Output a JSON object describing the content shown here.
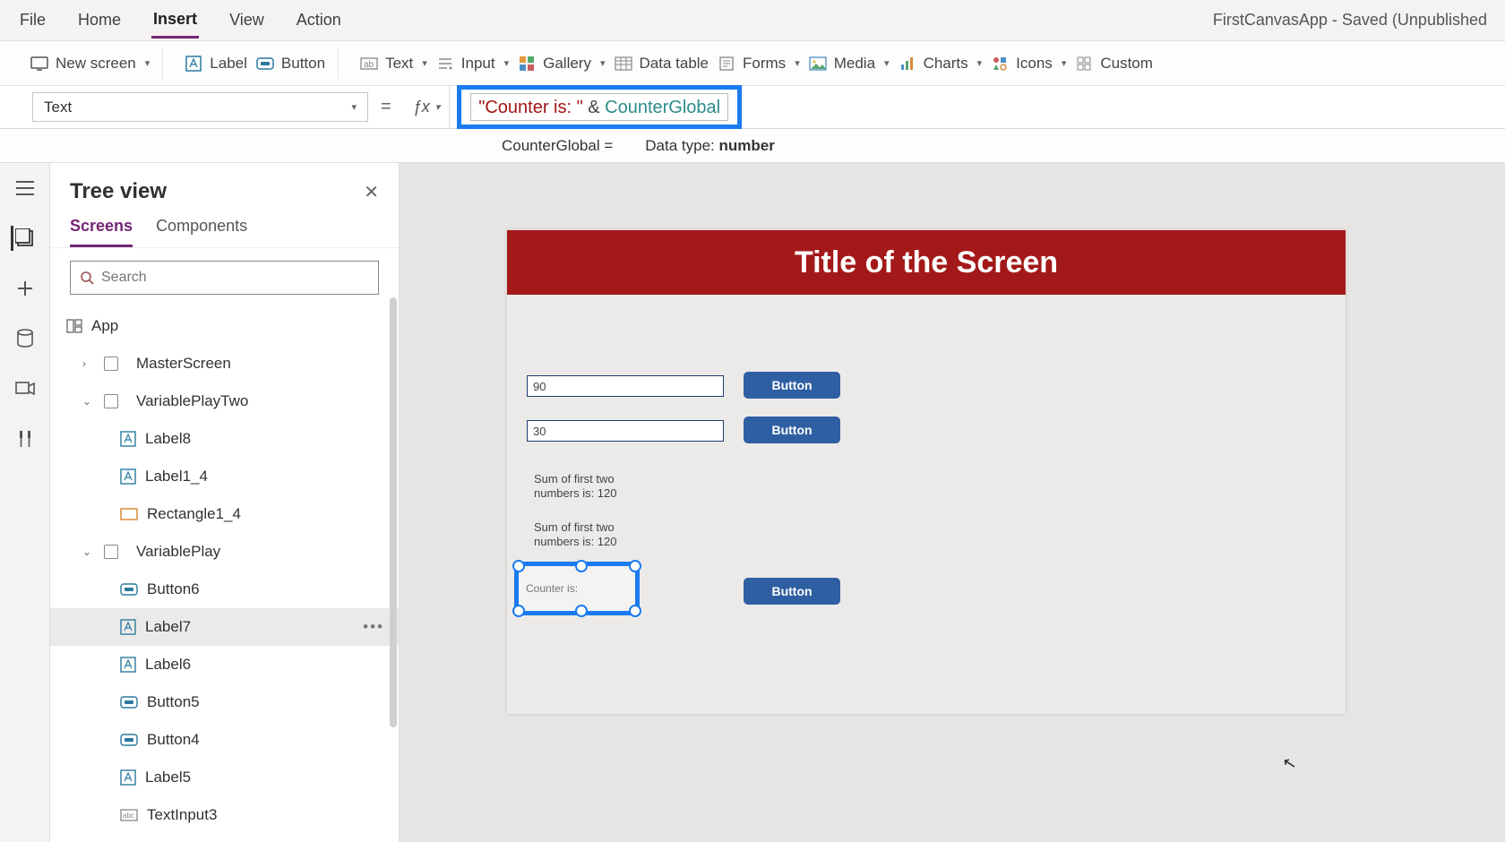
{
  "app_title": "FirstCanvasApp - Saved (Unpublished",
  "menubar": [
    "File",
    "Home",
    "Insert",
    "View",
    "Action"
  ],
  "menubar_active": "Insert",
  "ribbon": {
    "new_screen": "New screen",
    "label": "Label",
    "button": "Button",
    "text": "Text",
    "input": "Input",
    "gallery": "Gallery",
    "data_table": "Data table",
    "forms": "Forms",
    "media": "Media",
    "charts": "Charts",
    "icons": "Icons",
    "custom": "Custom"
  },
  "formula": {
    "property": "Text",
    "string_token": "\"Counter is: \"",
    "amp": " & ",
    "var_token": "CounterGlobal",
    "hint_var": "CounterGlobal",
    "hint_eq": " = ",
    "hint_dt_label": "Data type: ",
    "hint_dt_value": "number"
  },
  "tree": {
    "title": "Tree view",
    "tabs": {
      "screens": "Screens",
      "components": "Components"
    },
    "search_placeholder": "Search",
    "items": [
      {
        "label": "App",
        "icon": "app",
        "depth": 0
      },
      {
        "label": "MasterScreen",
        "icon": "screen",
        "depth": 1,
        "caret": "›",
        "chk": true
      },
      {
        "label": "VariablePlayTwo",
        "icon": "screen",
        "depth": 1,
        "caret": "⌄",
        "chk": true
      },
      {
        "label": "Label8",
        "icon": "label",
        "depth": 2
      },
      {
        "label": "Label1_4",
        "icon": "label",
        "depth": 2
      },
      {
        "label": "Rectangle1_4",
        "icon": "rect",
        "depth": 2
      },
      {
        "label": "VariablePlay",
        "icon": "screen",
        "depth": 1,
        "caret": "⌄",
        "chk": true
      },
      {
        "label": "Button6",
        "icon": "button",
        "depth": 2
      },
      {
        "label": "Label7",
        "icon": "label",
        "depth": 2,
        "selected": true
      },
      {
        "label": "Label6",
        "icon": "label",
        "depth": 2
      },
      {
        "label": "Button5",
        "icon": "button",
        "depth": 2
      },
      {
        "label": "Button4",
        "icon": "button",
        "depth": 2
      },
      {
        "label": "Label5",
        "icon": "label",
        "depth": 2
      },
      {
        "label": "TextInput3",
        "icon": "input",
        "depth": 2
      }
    ]
  },
  "canvas": {
    "title": "Title of the Screen",
    "input1": "90",
    "input2": "30",
    "btn_label": "Button",
    "sum_label_a": "Sum of first two",
    "sum_label_b": "numbers is: 120",
    "selected_text": "Counter is:"
  }
}
